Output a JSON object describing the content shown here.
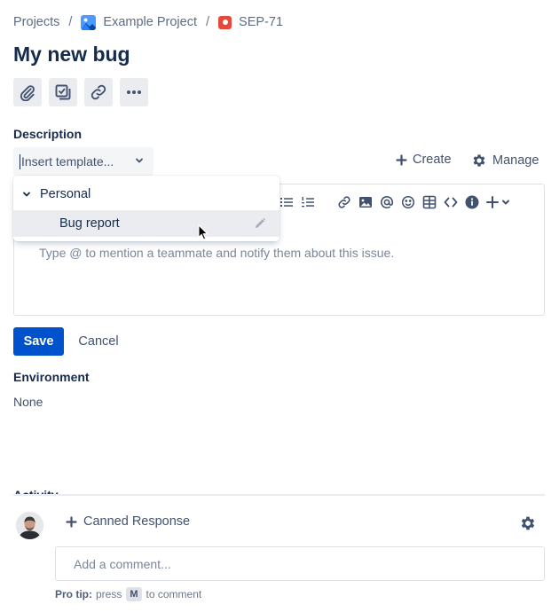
{
  "breadcrumb": {
    "projects": "Projects",
    "project": "Example Project",
    "issue_key": "SEP-71",
    "separator": "/"
  },
  "issue": {
    "title": "My new bug"
  },
  "toolbar": {
    "icons": [
      "paperclip-icon",
      "checklist-icon",
      "link-icon",
      "more-icon"
    ]
  },
  "description": {
    "label": "Description",
    "template_select": "Insert template...",
    "create_label": "Create",
    "manage_label": "Manage",
    "placeholder": "Type @ to mention a teammate and notify them about this issue."
  },
  "template_dropdown": {
    "group_label": "Personal",
    "items": [
      {
        "label": "Bug report"
      }
    ]
  },
  "actions": {
    "save_label": "Save",
    "cancel_label": "Cancel"
  },
  "environment": {
    "label": "Environment",
    "value": "None"
  },
  "activity": {
    "label": "Activity",
    "canned_response_label": "Canned Response",
    "comment_placeholder": "Add a comment...",
    "protip_bold": "Pro tip:",
    "protip_press": "press",
    "protip_key": "M",
    "protip_tail": "to comment"
  },
  "colors": {
    "primary": "#0052cc",
    "text": "#172b4d",
    "subtle_text": "#42526e",
    "bug_red": "#e5493a",
    "project_blue": "#4c9aff"
  }
}
